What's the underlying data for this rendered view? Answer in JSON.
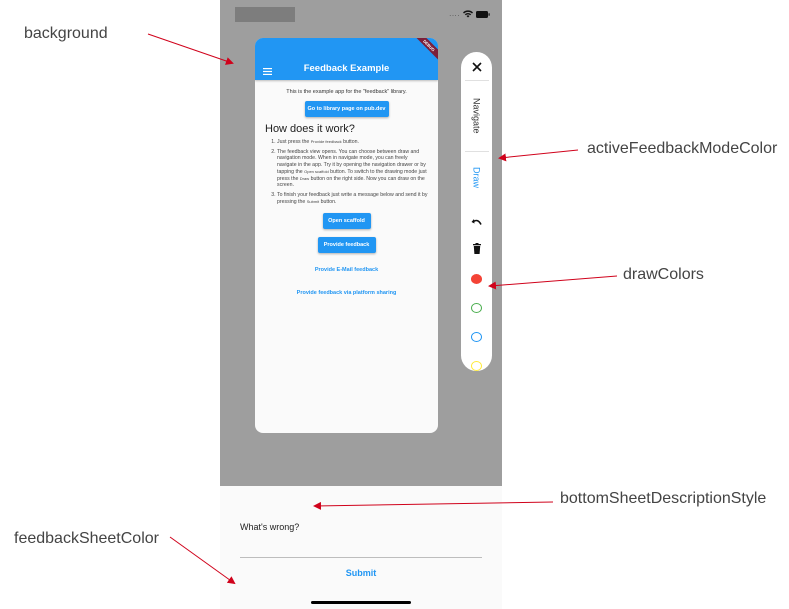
{
  "status_bar": {
    "signal_label": "....",
    "wifi_icon": "wifi-icon",
    "battery_icon": "battery-icon"
  },
  "app": {
    "title": "Feedback Example",
    "menu_icon": "menu-icon",
    "debug_banner": "DEBUG",
    "intro": "This is the example app for the \"feedback\" library.",
    "library_button": "Go to library page on pub.dev",
    "heading": "How does it work?",
    "steps": [
      {
        "pre": "Just press the ",
        "code": "Provide feedback",
        "post": " button."
      },
      {
        "pre": "The feedback view opens. You can choose between draw and navigation mode. When in navigate mode, you can freely navigate in the app. Try it by opening the navigation drawer or by tapping the ",
        "code": "Open scaffold",
        "mid": " button. To switch to the drawing mode just press the ",
        "code2": "Draw",
        "post": " button on the right side. Now you can draw on the screen."
      },
      {
        "pre": "To finish your feedback just write a message below and send it by pressing the ",
        "code": "Submit",
        "post": " button."
      }
    ],
    "open_scaffold_button": "Open scaffold",
    "provide_feedback_button": "Provide feedback",
    "email_feedback_link": "Provide E-Mail feedback",
    "platform_sharing_link": "Provide feedback via platform sharing"
  },
  "controls": {
    "close_icon": "close-icon",
    "navigate_label": "Navigate",
    "draw_label": "Draw",
    "active_mode": "Draw",
    "undo_icon": "undo-icon",
    "delete_icon": "trash-icon",
    "draw_colors": [
      {
        "name": "red",
        "hex": "#f44336",
        "selected": true
      },
      {
        "name": "green",
        "hex": "#4caf50",
        "selected": false
      },
      {
        "name": "blue",
        "hex": "#2196f3",
        "selected": false
      },
      {
        "name": "yellow",
        "hex": "#ffeb3b",
        "selected": false
      }
    ]
  },
  "sheet": {
    "description": "What's wrong?",
    "input_value": "",
    "submit_label": "Submit"
  },
  "annotations": {
    "background": "background",
    "active_mode_color": "activeFeedbackModeColor",
    "draw_colors": "drawColors",
    "description_style": "bottomSheetDescriptionStyle",
    "sheet_color": "feedbackSheetColor"
  },
  "colors": {
    "accent": "#2196f3",
    "background": "#9e9e9e",
    "sheet": "#fafafa",
    "annotation_arrow": "#d0021b"
  }
}
